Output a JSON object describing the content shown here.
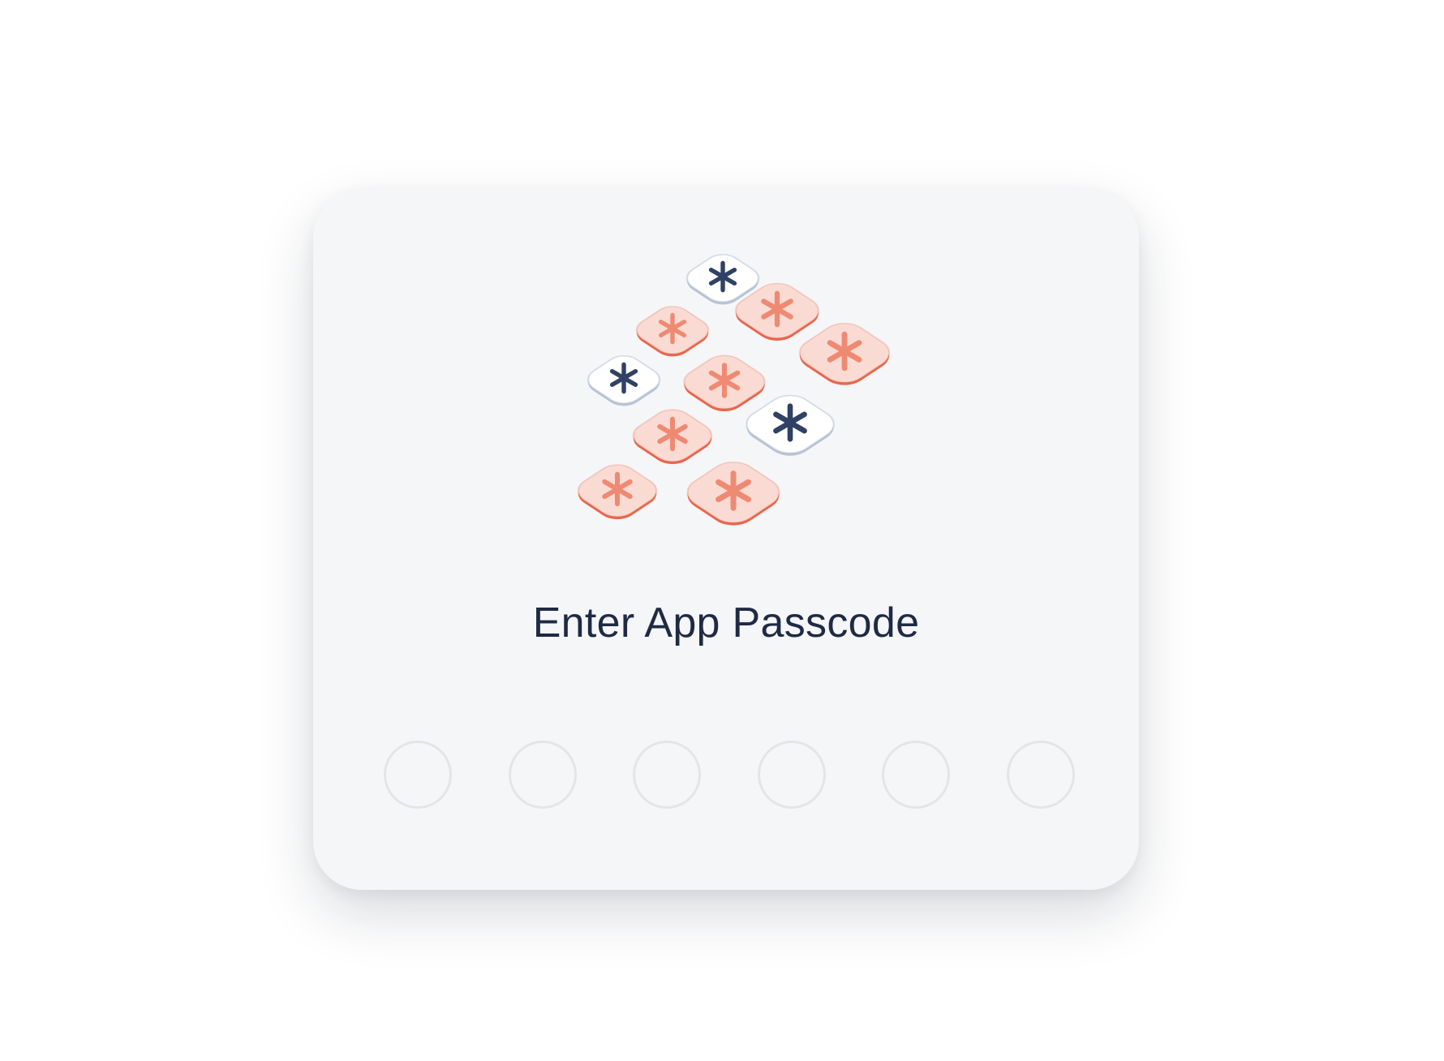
{
  "dialog": {
    "title": "Enter App Passcode",
    "illustration_icon": "keypad-asterisk-icon"
  },
  "passcode": {
    "length": 6,
    "filled": 0
  },
  "colors": {
    "card_background": "#f5f6f8",
    "title_text": "#1f2a44",
    "key_coral": "#fadbd4",
    "key_coral_edge": "#e8664b",
    "key_coral_star": "#ef8a72",
    "key_white": "#ffffff",
    "key_white_edge": "#b7c3d6",
    "key_white_star": "#2f4164",
    "dot_border": "#e3e5e8"
  }
}
